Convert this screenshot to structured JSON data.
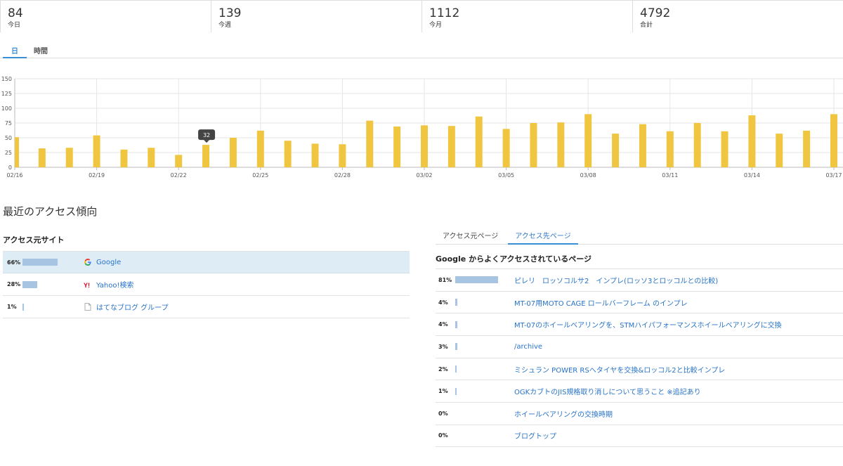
{
  "stats": [
    {
      "value": "84",
      "label": "今日"
    },
    {
      "value": "139",
      "label": "今週"
    },
    {
      "value": "1112",
      "label": "今月"
    },
    {
      "value": "4792",
      "label": "合計"
    }
  ],
  "tabs": [
    {
      "label": "日",
      "active": true
    },
    {
      "label": "時間",
      "active": false
    }
  ],
  "chart_data": {
    "type": "bar",
    "title": "",
    "xlabel": "",
    "ylabel": "",
    "ylim": [
      0,
      150
    ],
    "yticks": [
      0,
      25,
      50,
      75,
      100,
      125,
      150
    ],
    "categories": [
      "02/16",
      "02/17",
      "02/18",
      "02/19",
      "02/20",
      "02/21",
      "02/22",
      "02/23",
      "02/24",
      "02/25",
      "02/26",
      "02/27",
      "02/28",
      "02/29",
      "03/01",
      "03/02",
      "03/03",
      "03/04",
      "03/05",
      "03/06",
      "03/07",
      "03/08",
      "03/09",
      "03/10",
      "03/11",
      "03/12",
      "03/13",
      "03/14",
      "03/15",
      "03/16",
      "03/17"
    ],
    "tick_labels": [
      "02/16",
      "02/19",
      "02/22",
      "02/25",
      "02/28",
      "03/02",
      "03/05",
      "03/08",
      "03/11",
      "03/14",
      "03/17"
    ],
    "values": [
      51,
      32,
      33,
      54,
      30,
      33,
      21,
      38,
      50,
      62,
      45,
      40,
      39,
      79,
      69,
      71,
      70,
      86,
      65,
      75,
      76,
      90,
      57,
      73,
      61,
      75,
      61,
      88,
      57,
      62,
      90
    ],
    "bar_color": "#f0c640",
    "tooltip": {
      "index": 7,
      "text": "32"
    },
    "grid": true
  },
  "section_title": "最近のアクセス傾向",
  "referrers": {
    "title": "アクセス元サイト",
    "items": [
      {
        "pct": "66%",
        "ratio": 0.66,
        "name": "Google",
        "icon": "google-icon",
        "highlight": true
      },
      {
        "pct": "28%",
        "ratio": 0.28,
        "name": "Yahoo!検索",
        "icon": "yahoo-icon",
        "highlight": false
      },
      {
        "pct": "1%",
        "ratio": 0.01,
        "name": "はてなブログ グループ",
        "icon": "document-icon",
        "highlight": false
      }
    ]
  },
  "right_tabs": [
    {
      "label": "アクセス元ページ",
      "active": false
    },
    {
      "label": "アクセス先ページ",
      "active": true
    }
  ],
  "pages": {
    "title": "Google からよくアクセスされているページ",
    "items": [
      {
        "pct": "81%",
        "ratio": 0.81,
        "title": "ピレリ　ロッソコルサ2　インプレ(ロッソ3とロッコルとの比較)"
      },
      {
        "pct": "4%",
        "ratio": 0.04,
        "title": "MT-07用MOTO CAGE ロールバーフレーム のインプレ"
      },
      {
        "pct": "4%",
        "ratio": 0.04,
        "title": "MT-07のホイールベアリングを、STMハイパフォーマンスホイールベアリングに交換"
      },
      {
        "pct": "3%",
        "ratio": 0.03,
        "title": "/archive"
      },
      {
        "pct": "2%",
        "ratio": 0.02,
        "title": "ミシュラン POWER RSへタイヤを交換&ロッコル2と比較インプレ"
      },
      {
        "pct": "1%",
        "ratio": 0.01,
        "title": "OGKカブトのJIS規格取り消しについて思うこと ※追記あり"
      },
      {
        "pct": "0%",
        "ratio": 0,
        "title": "ホイールベアリングの交換時期"
      },
      {
        "pct": "0%",
        "ratio": 0,
        "title": "ブログトップ"
      }
    ]
  }
}
